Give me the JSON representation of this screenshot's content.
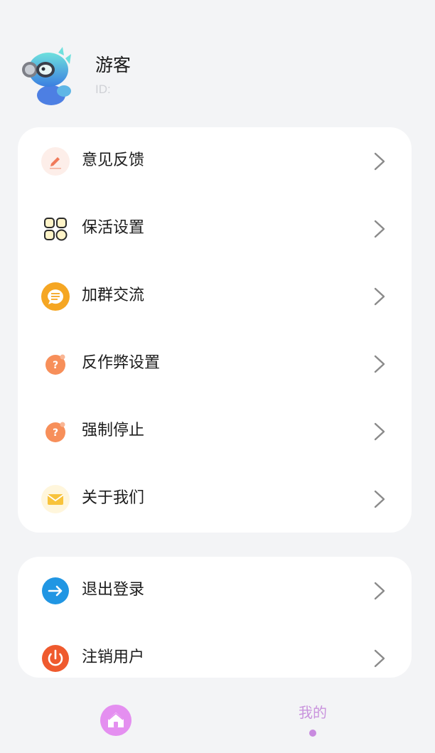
{
  "profile": {
    "name": "游客",
    "id_label": "ID:"
  },
  "menu_main": [
    {
      "label": "意见反馈",
      "icon": "feedback-pencil-icon"
    },
    {
      "label": "保活设置",
      "icon": "grid-apps-icon"
    },
    {
      "label": "加群交流",
      "icon": "chat-bubble-icon"
    },
    {
      "label": "反作弊设置",
      "icon": "question-icon"
    },
    {
      "label": "强制停止",
      "icon": "question-icon"
    },
    {
      "label": "关于我们",
      "icon": "mail-envelope-icon"
    }
  ],
  "menu_account": [
    {
      "label": "退出登录",
      "icon": "arrow-right-circle-icon"
    },
    {
      "label": "注销用户",
      "icon": "power-icon"
    }
  ],
  "tabbar": {
    "home_icon": "home-icon",
    "mine_label": "我的"
  },
  "colors": {
    "background": "#f3f4f6",
    "card": "#ffffff",
    "accent_purple": "#c993dd",
    "feedback_red": "#f07a5a",
    "chat_orange": "#f5a623",
    "question_orange": "#f78f5a",
    "mail_yellow": "#f8c33c",
    "logout_blue": "#2196e3",
    "power_red": "#ef5a2e"
  }
}
